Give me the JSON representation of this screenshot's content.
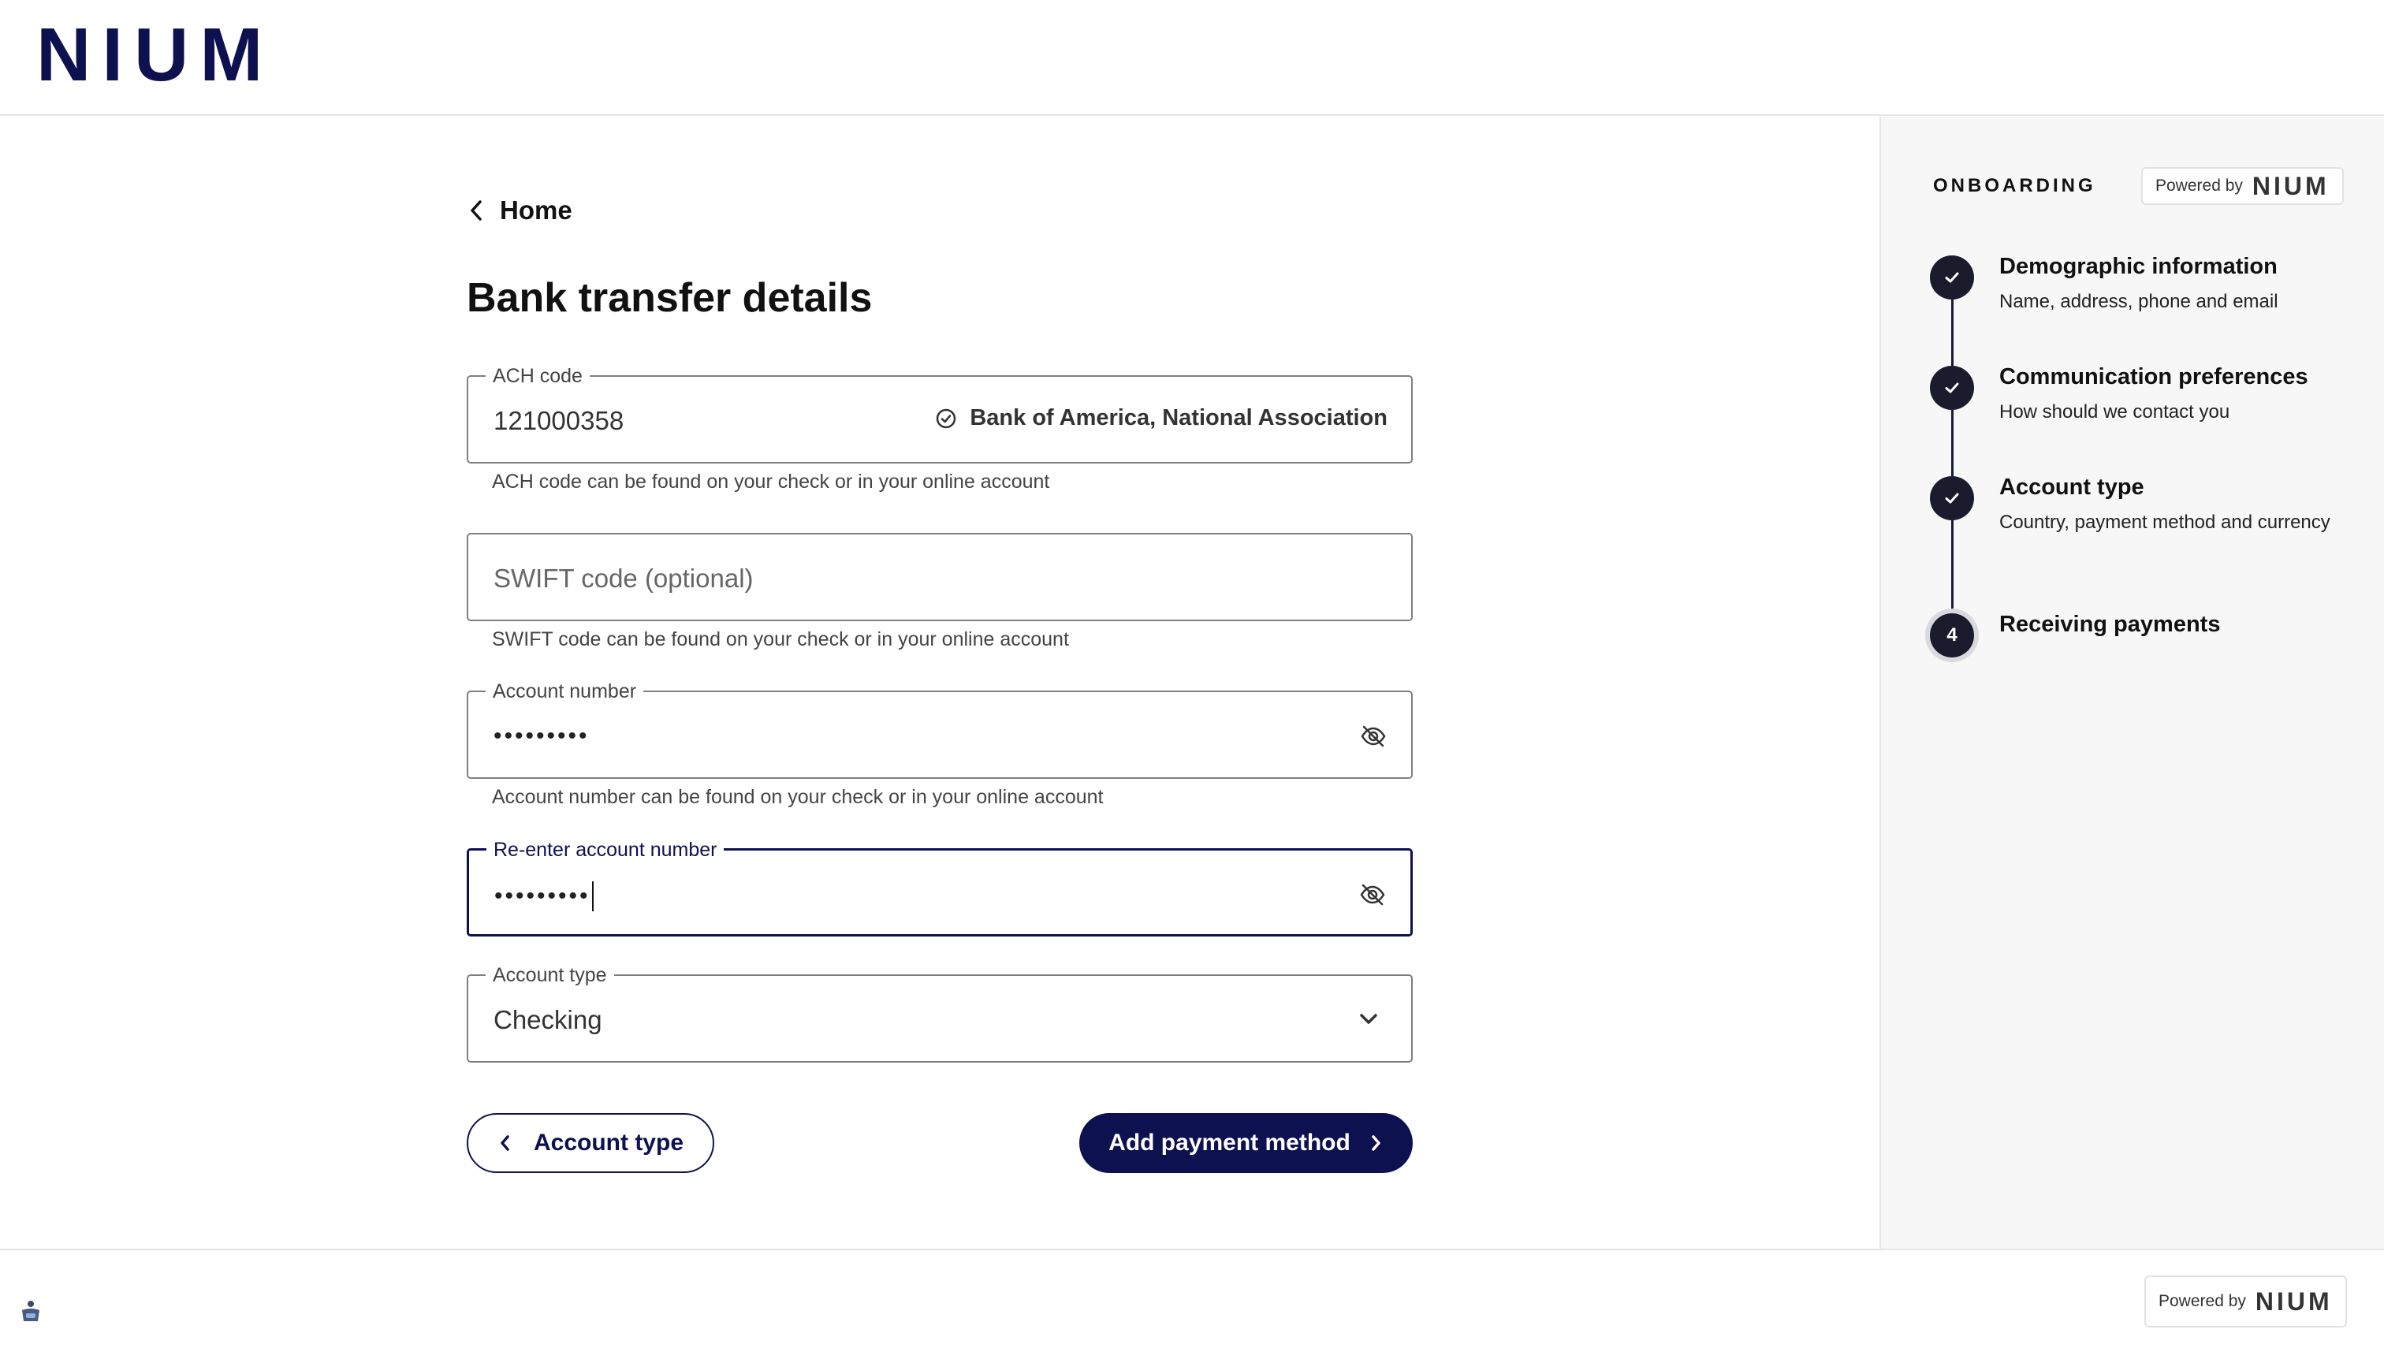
{
  "brand": {
    "logo_text": "NIUM",
    "primary_color": "#0e1150"
  },
  "nav": {
    "back_label": "Home"
  },
  "page": {
    "title": "Bank transfer details"
  },
  "form": {
    "ach": {
      "label": "ACH code",
      "value": "121000358",
      "bank_name": "Bank of America, National Association",
      "helper": "ACH code can be found on your check or in your online account"
    },
    "swift": {
      "placeholder": "SWIFT code (optional)",
      "helper": "SWIFT code can be found on your check or in your online account"
    },
    "account_number": {
      "label": "Account number",
      "masked_value": "•••••••••",
      "helper": "Account number can be found on your check or in your online account"
    },
    "reenter_account_number": {
      "label": "Re-enter account number",
      "masked_value": "•••••••••"
    },
    "account_type": {
      "label": "Account type",
      "selected": "Checking"
    }
  },
  "actions": {
    "back_label": "Account type",
    "primary_label": "Add payment method"
  },
  "sidebar": {
    "title": "ONBOARDING",
    "powered_text": "Powered by",
    "powered_logo": "NIUM",
    "steps": [
      {
        "status": "complete",
        "title": "Demographic information",
        "description": "Name, address, phone and email"
      },
      {
        "status": "complete",
        "title": "Communication preferences",
        "description": "How should we contact you"
      },
      {
        "status": "complete",
        "title": "Account type",
        "description": "Country, payment method and currency"
      },
      {
        "status": "current",
        "number": "4",
        "title": "Receiving payments",
        "description": ""
      }
    ]
  },
  "footer": {
    "powered_text": "Powered by",
    "powered_logo": "NIUM",
    "icon": "accessibility-widget-icon"
  }
}
